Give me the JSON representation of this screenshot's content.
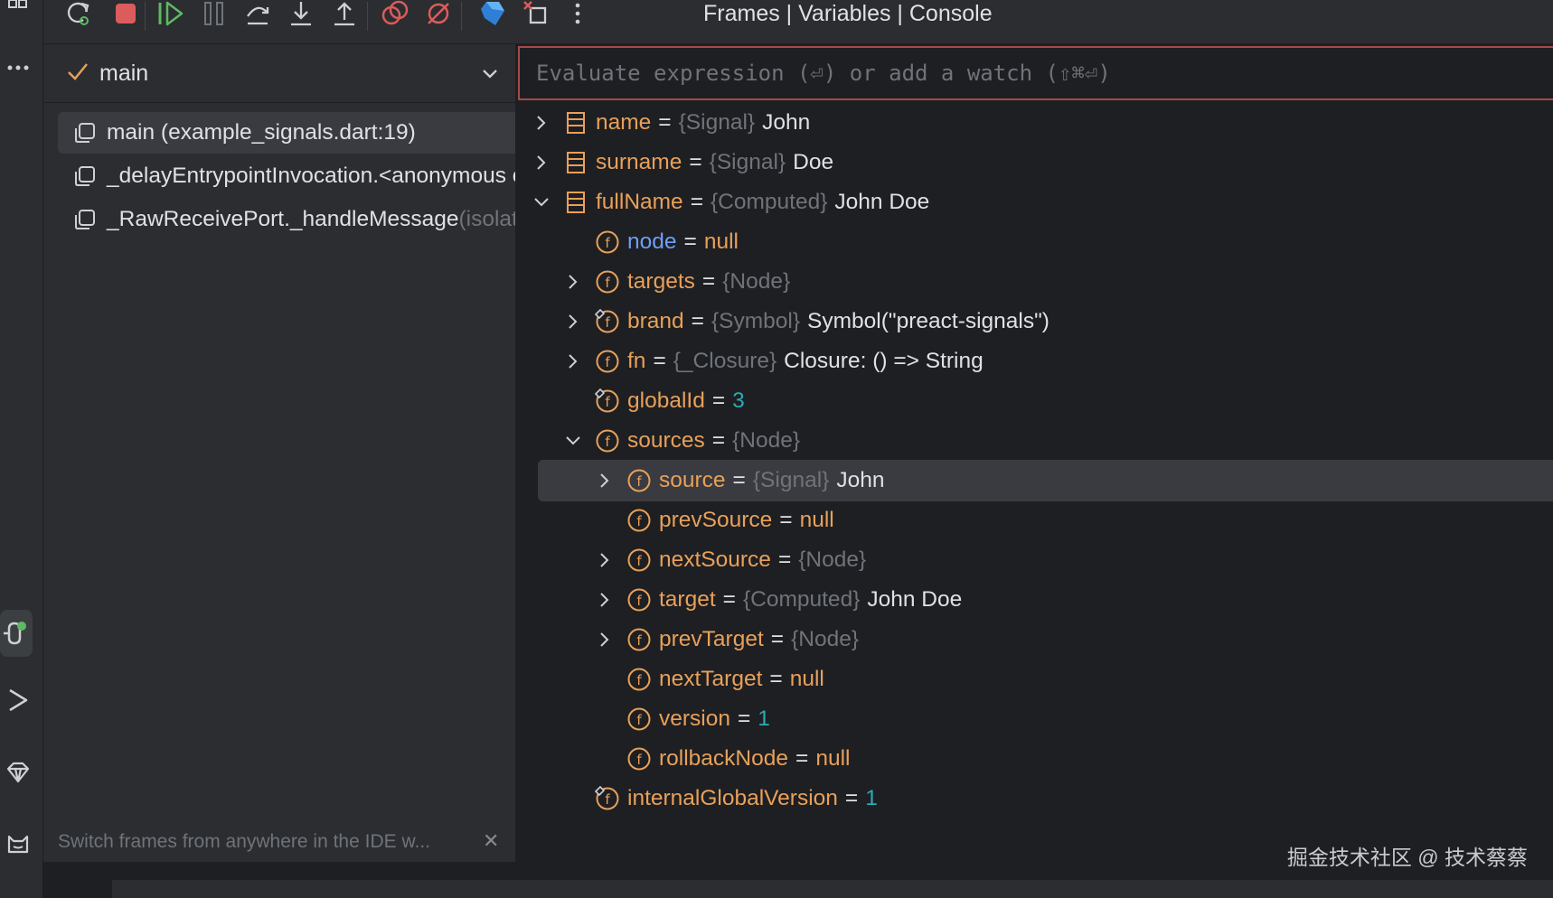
{
  "toolbar": {
    "title": "Frames | Variables | Console",
    "buttons": [
      "rerun-icon",
      "stop-icon",
      "resume-icon",
      "pause-icon",
      "step-over-icon",
      "step-into-icon",
      "step-out-icon",
      "view-breakpoints-icon",
      "mute-breakpoints-icon",
      "dart-devtools-icon",
      "close-session-icon",
      "more-icon"
    ]
  },
  "thread": {
    "selected": "main"
  },
  "frames": [
    {
      "text": "main (example_signals.dart:19)",
      "suffix": ""
    },
    {
      "text": "_delayEntrypointInvocation.<anonymous closure>",
      "suffix": ""
    },
    {
      "text": "_RawReceivePort._handleMessage",
      "suffix": " (isolate_patch.dart)"
    }
  ],
  "hint": "Switch frames from anywhere in the IDE w...",
  "eval": {
    "placeholder": "Evaluate expression (⏎) or add a watch (⇧⌘⏎)"
  },
  "vars": [
    {
      "name": "name",
      "type": "{Signal}",
      "value": "John"
    },
    {
      "name": "surname",
      "type": "{Signal}",
      "value": "Doe"
    },
    {
      "name": "fullName",
      "type": "{Computed}",
      "value": "John Doe"
    },
    {
      "name": "node",
      "type": "",
      "value": "null"
    },
    {
      "name": "targets",
      "type": "{Node}",
      "value": ""
    },
    {
      "name": "brand",
      "type": "{Symbol}",
      "value": "Symbol(\"preact-signals\")"
    },
    {
      "name": "fn",
      "type": "{_Closure}",
      "value": "Closure: () => String"
    },
    {
      "name": "globalId",
      "type": "",
      "value": "3"
    },
    {
      "name": "sources",
      "type": "{Node}",
      "value": ""
    },
    {
      "name": "source",
      "type": "{Signal}",
      "value": "John"
    },
    {
      "name": "prevSource",
      "type": "",
      "value": "null"
    },
    {
      "name": "nextSource",
      "type": "{Node}",
      "value": ""
    },
    {
      "name": "target",
      "type": "{Computed}",
      "value": "John Doe"
    },
    {
      "name": "prevTarget",
      "type": "{Node}",
      "value": ""
    },
    {
      "name": "nextTarget",
      "type": "",
      "value": "null"
    },
    {
      "name": "version",
      "type": "",
      "value": "1"
    },
    {
      "name": "rollbackNode",
      "type": "",
      "value": "null"
    },
    {
      "name": "internalGlobalVersion",
      "type": "",
      "value": "1"
    }
  ],
  "watermark": "掘金技术社区 @ 技术蔡蔡",
  "colors": {
    "accent_red": "#a44a4c",
    "field_orange": "#e8a05a",
    "number_cyan": "#2aacb8",
    "special_blue": "#6f9ef8"
  }
}
